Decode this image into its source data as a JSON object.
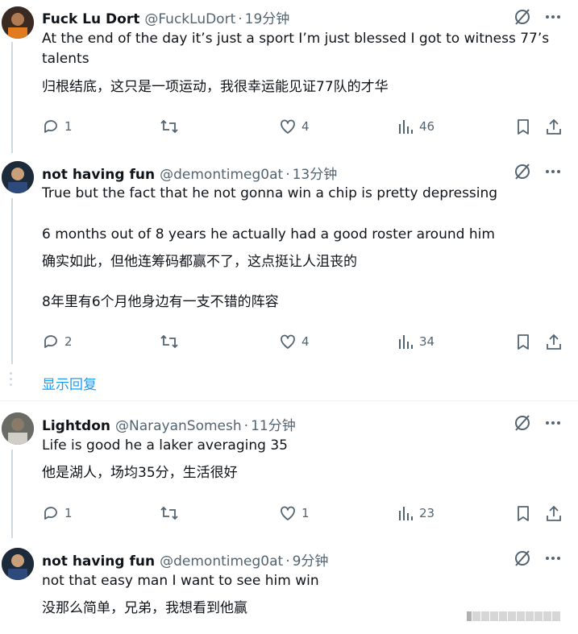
{
  "tweets": [
    {
      "name": "Fuck Lu Dort",
      "handle": "@FuckLuDort",
      "separator": "·",
      "time": "19分钟",
      "text_lines": [
        "At the end of the day it’s just a sport I’m just blessed I got to witness 77’s",
        "talents"
      ],
      "translation_lines": [
        "归根结底，这只是一项运动，我很幸运能见证77队的才华"
      ],
      "replies": "1",
      "retweets": "",
      "likes": "4",
      "views": "46"
    },
    {
      "name": "not having fun",
      "handle": "@demontimeg0at",
      "separator": "·",
      "time": "13分钟",
      "text_lines": [
        "True but the fact that he not gonna win a chip is pretty depressing",
        "",
        "6 months out of 8 years he actually had a good roster around him"
      ],
      "translation_lines": [
        "确实如此，但他连筹码都赢不了，这点挺让人沮丧的",
        "",
        "8年里有6个月他身边有一支不错的阵容"
      ],
      "replies": "2",
      "retweets": "",
      "likes": "4",
      "views": "34"
    },
    {
      "name": "Lightdon",
      "handle": "@NarayanSomesh",
      "separator": "·",
      "time": "11分钟",
      "text_lines": [
        "Life is good he a laker averaging 35"
      ],
      "translation_lines": [
        "他是湖人，场均35分，生活很好"
      ],
      "replies": "1",
      "retweets": "",
      "likes": "1",
      "views": "23"
    },
    {
      "name": "not having fun",
      "handle": "@demontimeg0at",
      "separator": "·",
      "time": "9分钟",
      "text_lines": [
        "not that easy man I want to see him win"
      ],
      "translation_lines": [
        "没那么简单，兄弟，我想看到他赢"
      ]
    }
  ],
  "show_replies": "显示回复",
  "icons": {
    "grok": "grok-icon",
    "more": "more-icon",
    "reply": "reply-icon",
    "retweet": "retweet-icon",
    "like": "like-icon",
    "views": "views-icon",
    "bookmark": "bookmark-icon",
    "share": "share-icon"
  },
  "colors": {
    "text": "#0f1419",
    "muted": "#536471",
    "link": "#1d9bf0",
    "line": "#cfd9de"
  }
}
